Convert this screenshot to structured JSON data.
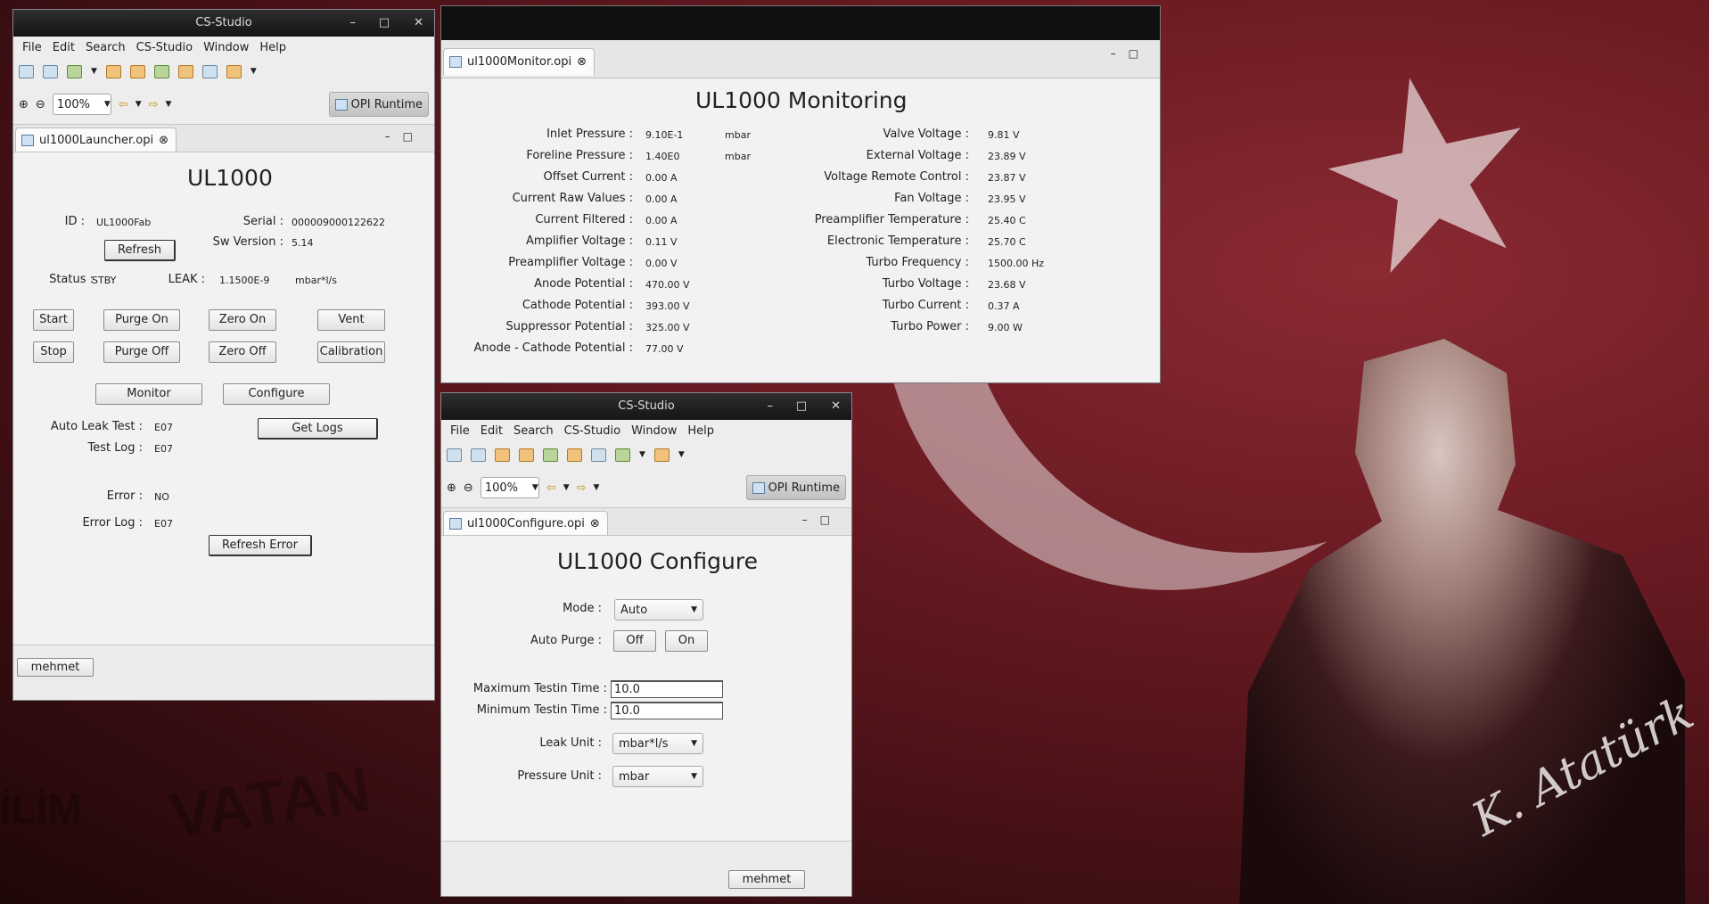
{
  "launcher_window": {
    "title": "CS-Studio",
    "menu": [
      "File",
      "Edit",
      "Search",
      "CS-Studio",
      "Window",
      "Help"
    ],
    "zoom": "100%",
    "perspective": "OPI Runtime",
    "tab": "ul1000Launcher.opi",
    "heading": "UL1000",
    "id_label": "ID :",
    "id_value": "UL1000Fab",
    "serial_label": "Serial :",
    "serial_value": "000009000122622",
    "sw_label": "Sw Version :",
    "sw_value": "5.14",
    "refresh": "Refresh",
    "status_label": "Status :",
    "status_value": "STBY",
    "leak_label": "LEAK :",
    "leak_value": "1.1500E-9",
    "leak_unit": "mbar*l/s",
    "buttons": [
      "Start",
      "Purge On",
      "Zero On",
      "Vent",
      "Stop",
      "Purge Off",
      "Zero Off",
      "Calibration"
    ],
    "monitor": "Monitor",
    "configure": "Configure",
    "auto_leak_label": "Auto Leak Test :",
    "auto_leak_value": "E07",
    "get_logs": "Get Logs",
    "test_log_label": "Test Log :",
    "test_log_value": "E07",
    "error_label": "Error :",
    "error_value": "NO",
    "error_log_label": "Error Log :",
    "error_log_value": "E07",
    "refresh_error": "Refresh Error",
    "user": "mehmet"
  },
  "monitor_window": {
    "tab": "ul1000Monitor.opi",
    "heading": "UL1000 Monitoring",
    "left": [
      {
        "label": "Inlet Pressure :",
        "value": "9.10E-1",
        "unit": "mbar"
      },
      {
        "label": "Foreline Pressure :",
        "value": "1.40E0",
        "unit": "mbar"
      },
      {
        "label": "Offset Current :",
        "value": "0.00 A",
        "unit": ""
      },
      {
        "label": "Current Raw Values :",
        "value": "0.00 A",
        "unit": ""
      },
      {
        "label": "Current Filtered :",
        "value": "0.00 A",
        "unit": ""
      },
      {
        "label": "Amplifier Voltage :",
        "value": "0.11 V",
        "unit": ""
      },
      {
        "label": "Preamplifier Voltage :",
        "value": "0.00 V",
        "unit": ""
      },
      {
        "label": "Anode Potential :",
        "value": "470.00 V",
        "unit": ""
      },
      {
        "label": "Cathode Potential :",
        "value": "393.00 V",
        "unit": ""
      },
      {
        "label": "Suppressor Potential :",
        "value": "325.00 V",
        "unit": ""
      },
      {
        "label": "Anode - Cathode Potential :",
        "value": "77.00 V",
        "unit": ""
      }
    ],
    "right": [
      {
        "label": "Valve Voltage :",
        "value": "9.81 V"
      },
      {
        "label": "External Voltage :",
        "value": "23.89 V"
      },
      {
        "label": "Voltage Remote Control :",
        "value": "23.87 V"
      },
      {
        "label": "Fan Voltage :",
        "value": "23.95 V"
      },
      {
        "label": "Preamplifier Temperature :",
        "value": "25.40 C"
      },
      {
        "label": "Electronic Temperature :",
        "value": "25.70 C"
      },
      {
        "label": "Turbo Frequency :",
        "value": "1500.00 Hz"
      },
      {
        "label": "Turbo Voltage :",
        "value": "23.68 V"
      },
      {
        "label": "Turbo Current :",
        "value": "0.37 A"
      },
      {
        "label": "Turbo Power :",
        "value": "9.00 W"
      }
    ]
  },
  "configure_window": {
    "title": "CS-Studio",
    "menu": [
      "File",
      "Edit",
      "Search",
      "CS-Studio",
      "Window",
      "Help"
    ],
    "zoom": "100%",
    "perspective": "OPI Runtime",
    "tab": "ul1000Configure.opi",
    "heading": "UL1000 Configure",
    "mode_label": "Mode :",
    "mode_value": "Auto",
    "auto_purge_label": "Auto Purge :",
    "off": "Off",
    "on": "On",
    "max_label": "Maximum Testin Time :",
    "max_value": "10.0",
    "min_label": "Minimum Testin Time :",
    "min_value": "10.0",
    "leak_unit_label": "Leak Unit :",
    "leak_unit_value": "mbar*l/s",
    "pressure_unit_label": "Pressure Unit :",
    "pressure_unit_value": "mbar",
    "user": "mehmet"
  },
  "desktop": {
    "signature": "K. Atatürk",
    "watermark_1": "VATAN",
    "watermark_2": "İLİM"
  }
}
